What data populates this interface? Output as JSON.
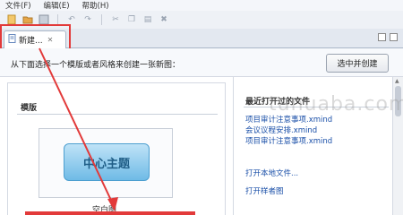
{
  "menu": {
    "file": "文件(F)",
    "edit": "编辑(E)",
    "help": "帮助(H)"
  },
  "tab": {
    "label": "新建...",
    "close": "✕"
  },
  "prompt": {
    "text": "从下面选择一个模版或者风格来创建一张新图：",
    "open_button": "选中并创建"
  },
  "templates": {
    "section_title": "模版",
    "central_topic": "中心主题",
    "blank_label": "空白图"
  },
  "recent": {
    "section_title": "最近打开过的文件",
    "files": [
      "项目审计注意事项.xmind",
      "会议议程安排.xmind",
      "项目审计注意事项.xmind"
    ]
  },
  "actions": {
    "open_local": "打开本地文件...",
    "open_sample": "打开样者图"
  },
  "watermark": "tunuaba.com",
  "colors": {
    "highlight": "#e23a3a",
    "accent": "#6fbbe6",
    "link": "#1a4fa8"
  },
  "icons": [
    "save-icon",
    "undo-icon",
    "redo-icon",
    "cut-icon",
    "copy-icon",
    "paste-icon",
    "delete-icon"
  ]
}
